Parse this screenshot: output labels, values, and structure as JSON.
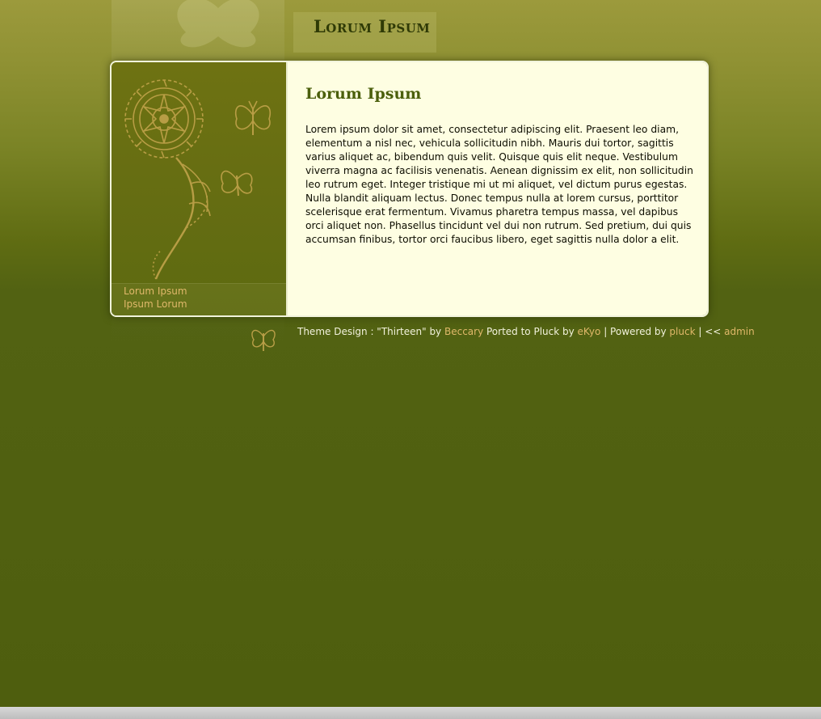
{
  "header": {
    "site_title": "Lorum Ipsum"
  },
  "sidebar": {
    "nav_items": [
      {
        "label": "Lorum Ipsum"
      },
      {
        "label": "Ipsum Lorum"
      }
    ]
  },
  "content": {
    "title": "Lorum Ipsum",
    "body": "Lorem ipsum dolor sit amet, consectetur adipiscing elit. Praesent leo diam, elementum a nisl nec, vehicula sollicitudin nibh. Mauris dui tortor, sagittis varius aliquet ac, bibendum quis velit. Quisque quis elit neque. Vestibulum viverra magna ac facilisis venenatis. Aenean dignissim ex elit, non sollicitudin leo rutrum eget. Integer tristique mi ut mi aliquet, vel dictum purus egestas. Nulla blandit aliquam lectus. Donec tempus nulla at lorem cursus, porttitor scelerisque erat fermentum. Vivamus pharetra tempus massa, vel dapibus orci aliquet non. Phasellus tincidunt vel dui non rutrum. Sed pretium, dui quis accumsan finibus, tortor orci faucibus libero, eget sagittis nulla dolor a elit."
  },
  "footer": {
    "prefix": "Theme Design : \"Thirteen\" by ",
    "designer_link": "Beccary",
    "ported_text": " Ported to Pluck by ",
    "porter_link": "eKyo",
    "separator1": " | Powered by ",
    "powered_link": "pluck",
    "separator2": " | << ",
    "admin_link": "admin"
  },
  "icons": {
    "decorative": [
      "flower-motif-icon",
      "butterfly-icon"
    ]
  },
  "colors": {
    "background_top": "#9c9a3c",
    "background_bottom": "#4e5e0e",
    "content_panel": "#fefee2",
    "title_text": "#4b5f0c",
    "link_text": "#e0b86a"
  }
}
